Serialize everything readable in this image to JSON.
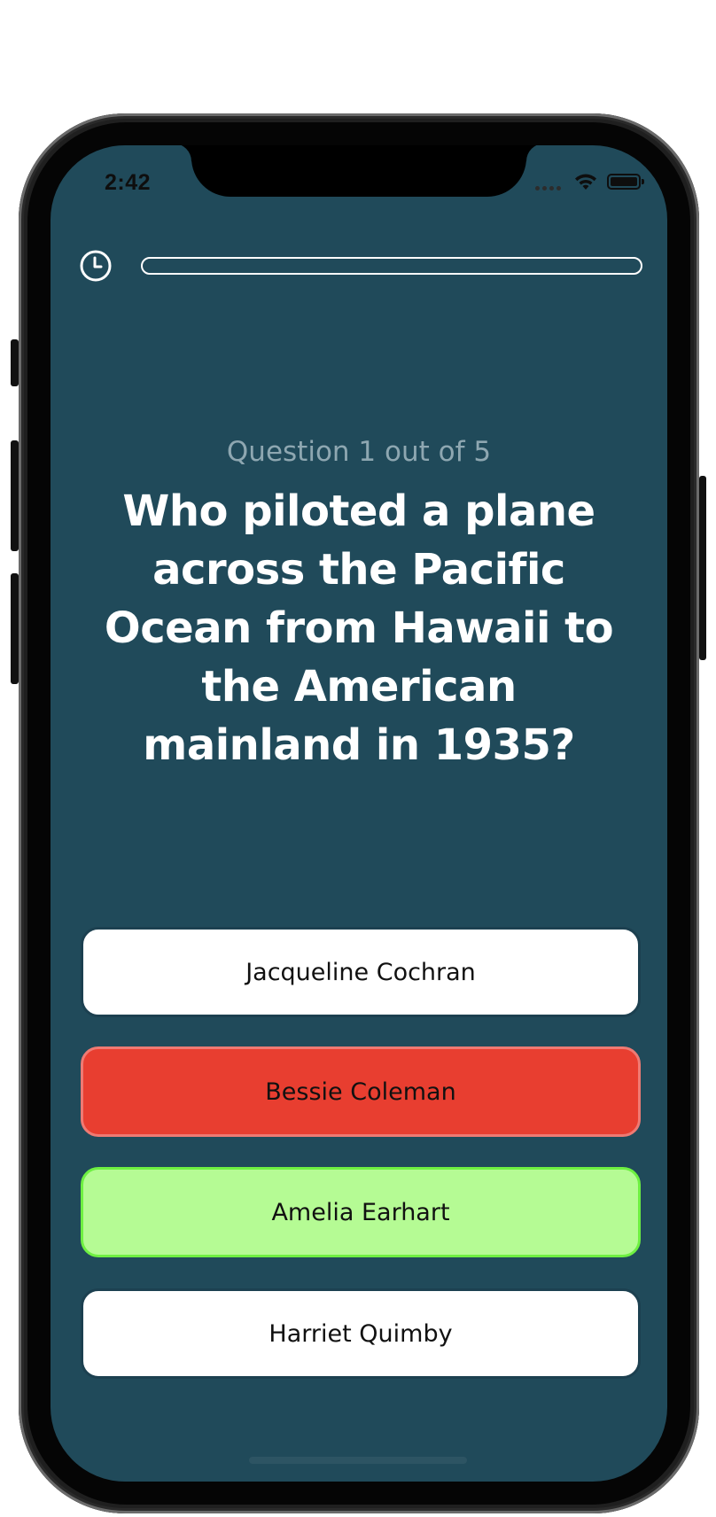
{
  "status_bar": {
    "time": "2:42",
    "signal_icon": "cellular-signal-icon",
    "wifi_icon": "wifi-icon",
    "battery_icon": "battery-icon",
    "battery_level": 1.0
  },
  "timer": {
    "icon": "clock-icon",
    "progress": 0.0
  },
  "question": {
    "counter": "Question 1 out of 5",
    "text": "Who piloted a plane across the Pacific Ocean from Hawaii to the American mainland in 1935?"
  },
  "answers": [
    {
      "label": "Jacqueline Cochran",
      "state": "neutral",
      "color": "#ffffff"
    },
    {
      "label": "Bessie Coleman",
      "state": "wrong",
      "color": "#e83e30"
    },
    {
      "label": "Amelia Earhart",
      "state": "correct",
      "color": "#b5fb94"
    },
    {
      "label": "Harriet Quimby",
      "state": "neutral",
      "color": "#ffffff"
    }
  ],
  "colors": {
    "background": "#204a5a",
    "muted_text": "#8ea7b1",
    "wrong": "#e83e30",
    "correct": "#b5fb94"
  }
}
